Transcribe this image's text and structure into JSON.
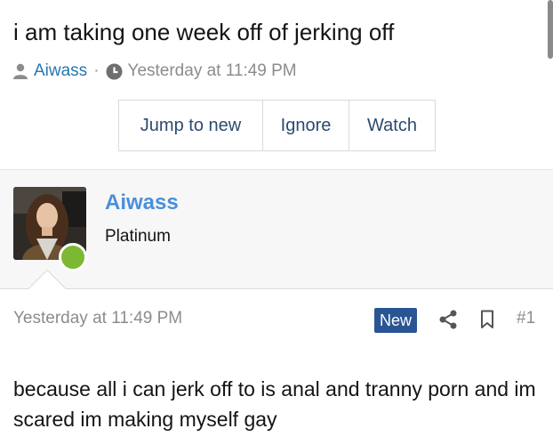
{
  "thread": {
    "title": "i am taking one week off of jerking off",
    "author": "Aiwass",
    "separator": "·",
    "timestamp": "Yesterday at 11:49 PM"
  },
  "actions": {
    "jump_label": "Jump to new",
    "ignore_label": "Ignore",
    "watch_label": "Watch"
  },
  "post": {
    "username": "Aiwass",
    "user_title": "Platinum",
    "date": "Yesterday at 11:49 PM",
    "new_badge": "New",
    "number": "#1",
    "body": "because all i can jerk off to is anal and tranny porn and im scared im making myself gay"
  },
  "icons": {
    "author": "user-icon",
    "time": "clock-icon",
    "share": "share-icon",
    "bookmark": "bookmark-icon"
  },
  "colors": {
    "link": "#2577b1",
    "username": "#4a90d9",
    "badge": "#2a5594",
    "online": "#7cb833"
  }
}
